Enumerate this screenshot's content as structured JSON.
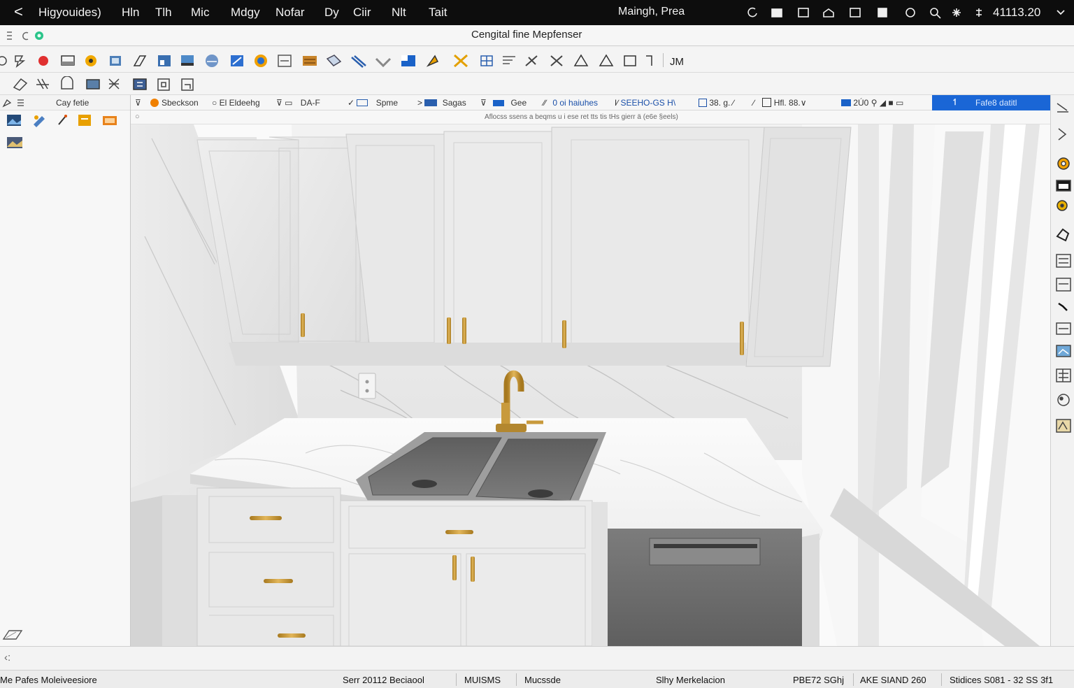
{
  "menubar": {
    "back_glyph": "<",
    "items": [
      "Higyouides)",
      "Hln",
      "Tlh",
      "Mic",
      "Mdgy",
      "Nofar",
      "Dy",
      "Ciir",
      "Nlt",
      "Tait"
    ],
    "center_text": "Maingh, Prea",
    "clock": "41113.20"
  },
  "titlebar": {
    "title": "Cengital fine Mepfenser"
  },
  "toolbar": {
    "extra_label": "JM"
  },
  "left_panel": {
    "header": "Cay fetie"
  },
  "options_bar": {
    "items": [
      "Sbeckson",
      "El Eldeehg",
      "DA-F",
      "Spme",
      "Sagas",
      "Gee",
      "0 oi haiuhes",
      "SEEHO-GS H\\",
      "38. g.",
      "Hfl. 88.∨",
      "2Ú0"
    ],
    "active_tab": "Fafe8 datitl"
  },
  "hint_bar": {
    "text": "Aflocss ssens a beqms u i ese ret tts tis tHs gierr ä (e6e §eels)"
  },
  "statusbar": {
    "left": "Me Pafes Moleiveesiore",
    "cell1": "Serr 20112 Beciaool",
    "cell2": "MUISMS",
    "cell3": "Mucssde",
    "cell4": "Slhy Merkelacion",
    "cell5": "PBE72 SGhj",
    "cell6": "AKE SIAND 260",
    "cell7": "Stidices S081 - 32 SS 3f1"
  },
  "colors": {
    "accent": "#1f6fe0",
    "active_tab": "#1a66d6",
    "brass": "#c89a3c",
    "cabinet": "#e8e8e8",
    "sink": "#6c6c6c"
  }
}
